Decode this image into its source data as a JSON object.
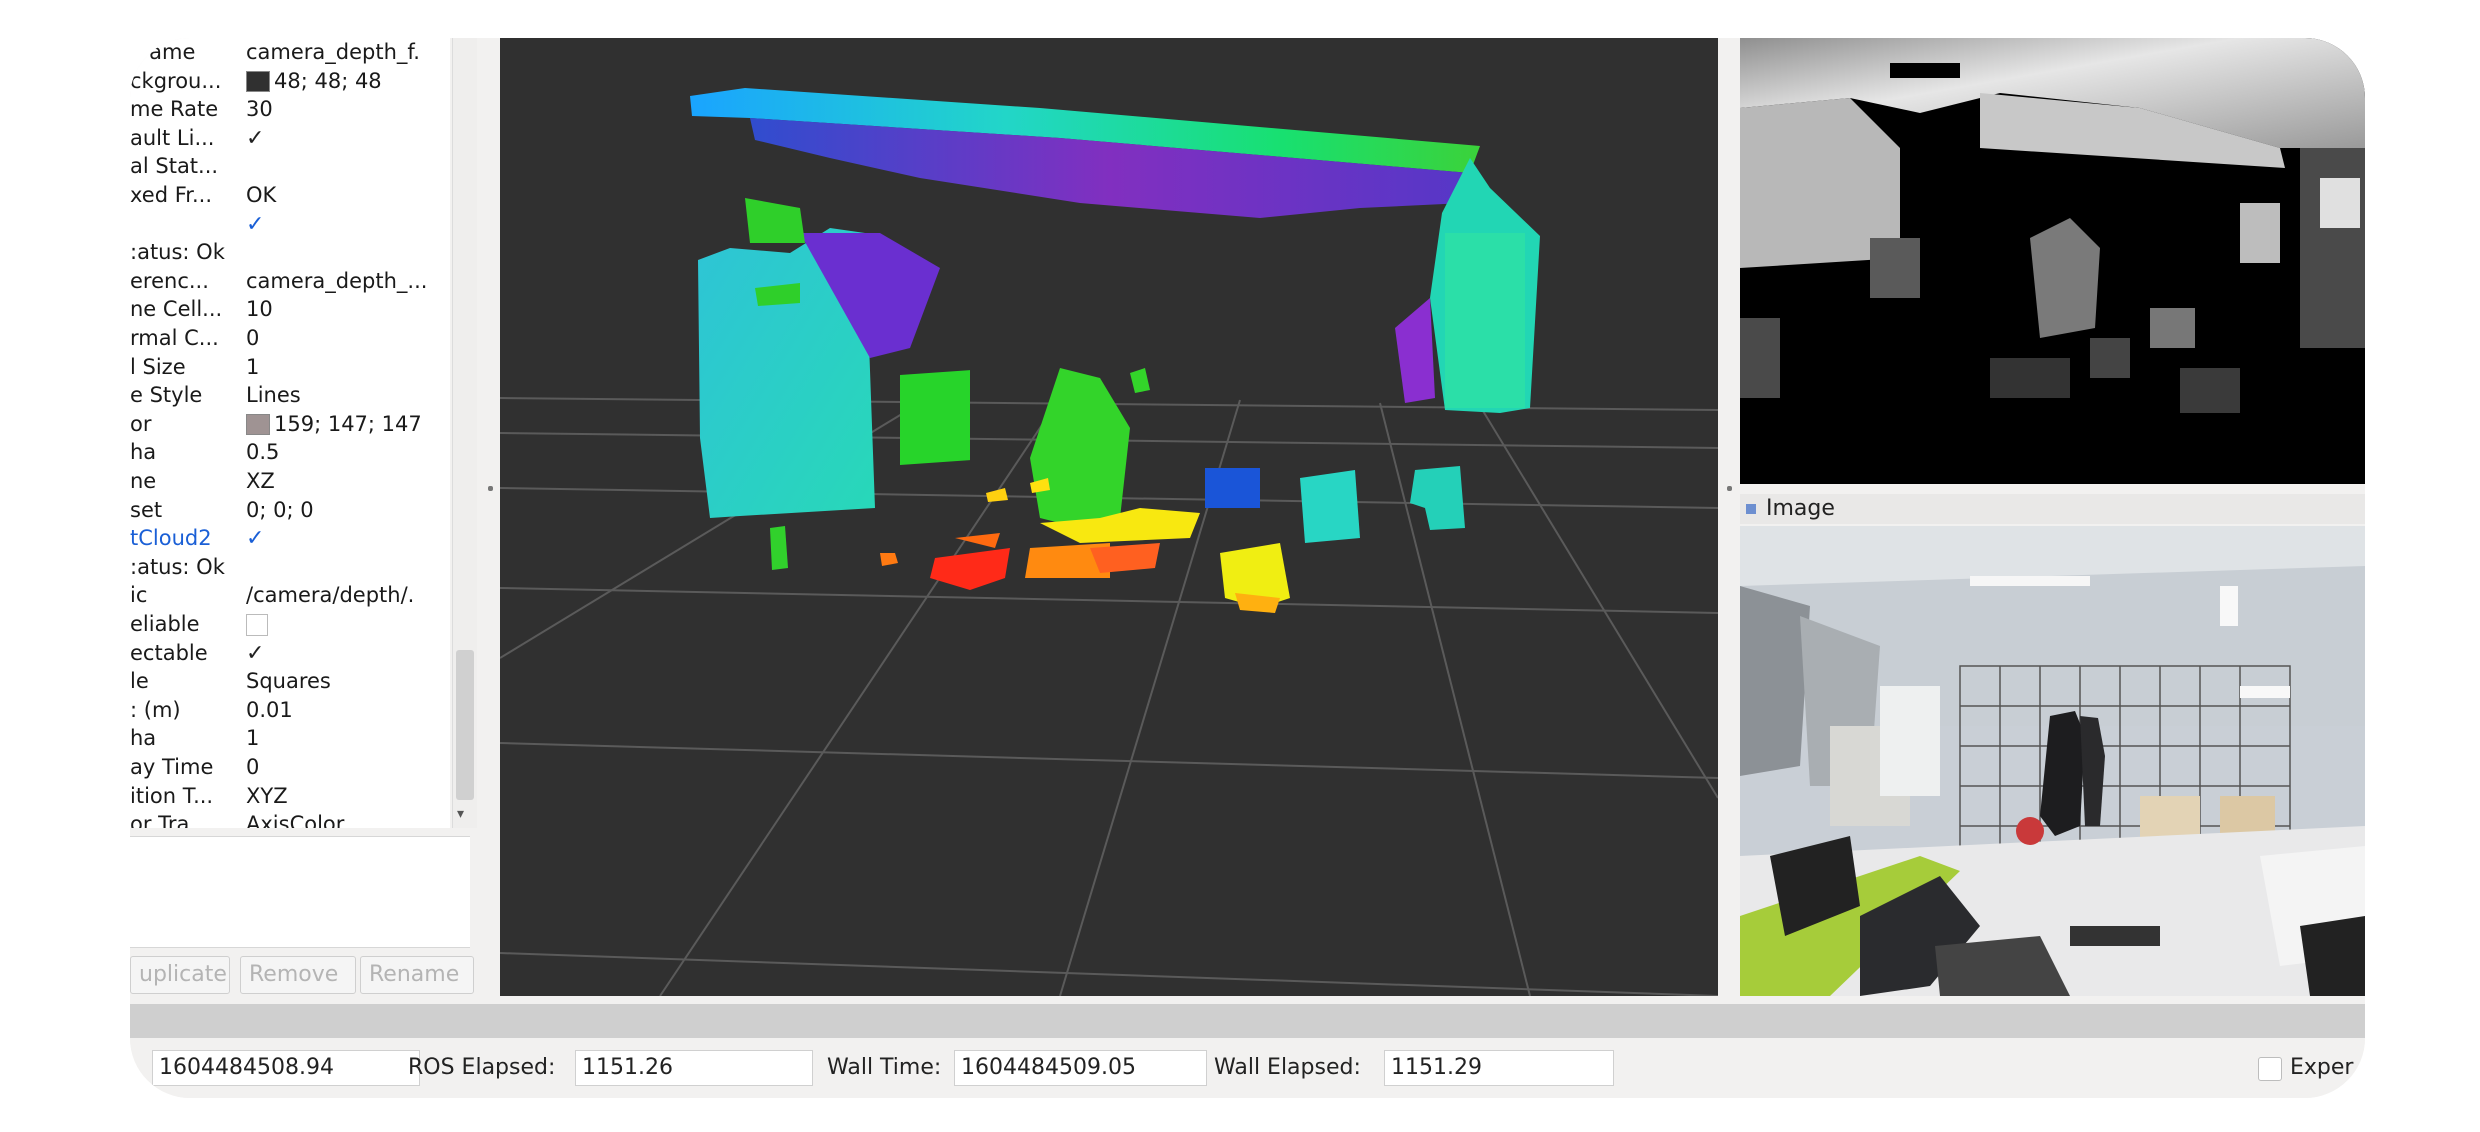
{
  "properties": [
    {
      "key": "Frame",
      "value": "camera_depth_f."
    },
    {
      "key": "ckgrou...",
      "value": "48; 48; 48",
      "swatch": "#303030"
    },
    {
      "key": "me Rate",
      "value": "30"
    },
    {
      "key": "ault Li...",
      "value": "",
      "check": true
    },
    {
      "key": "al Stat...",
      "value": ""
    },
    {
      "key": "xed Fr...",
      "value": "OK"
    },
    {
      "key": "",
      "value": "",
      "check_blue": true
    },
    {
      "key": ":atus: Ok",
      "value": ""
    },
    {
      "key": "erenc...",
      "value": "camera_depth_..."
    },
    {
      "key": "ne Cell...",
      "value": "10"
    },
    {
      "key": "rmal C...",
      "value": "0"
    },
    {
      "key": "l Size",
      "value": "1"
    },
    {
      "key": "e Style",
      "value": "Lines"
    },
    {
      "key": "or",
      "value": "159; 147; 147",
      "swatch": "#9f9393"
    },
    {
      "key": "ha",
      "value": "0.5"
    },
    {
      "key": "ne",
      "value": "XZ"
    },
    {
      "key": "set",
      "value": "0; 0; 0"
    },
    {
      "key": "tCloud2",
      "value": "",
      "check_blue": true,
      "blue_key": true
    },
    {
      "key": ":atus: Ok",
      "value": ""
    },
    {
      "key": "ic",
      "value": "/camera/depth/."
    },
    {
      "key": "eliable",
      "value": "",
      "check_empty": true
    },
    {
      "key": "ectable",
      "value": "",
      "check": true
    },
    {
      "key": "le",
      "value": "Squares"
    },
    {
      "key": ": (m)",
      "value": "0.01"
    },
    {
      "key": "ha",
      "value": "1"
    },
    {
      "key": "ay Time",
      "value": "0"
    },
    {
      "key": "ition T...",
      "value": "XYZ"
    },
    {
      "key": "or Tra",
      "value": "AxisColor"
    }
  ],
  "buttons": {
    "duplicate": "uplicate",
    "remove": "Remove",
    "rename": "Rename"
  },
  "image_panel": {
    "title": "Image"
  },
  "timebar": {
    "ros_time_label": ":",
    "ros_time_value": "1604484508.94",
    "ros_elapsed_label": "ROS Elapsed:",
    "ros_elapsed_value": "1151.26",
    "wall_time_label": "Wall Time:",
    "wall_time_value": "1604484509.05",
    "wall_elapsed_label": "Wall Elapsed:",
    "wall_elapsed_value": "1151.29",
    "experimental_label": "Exper"
  },
  "colors": {
    "viewport_background": "#303030",
    "grid_color": "#9f9393",
    "accent_blue": "#1a5fd6"
  }
}
